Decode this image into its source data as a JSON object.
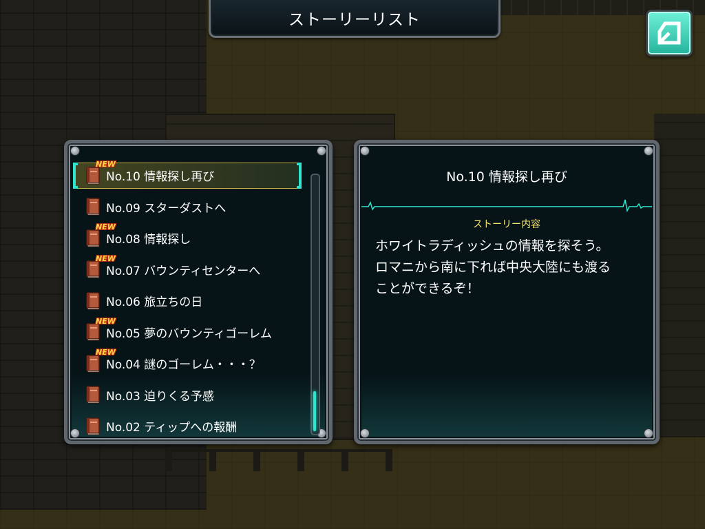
{
  "header": {
    "title": "ストーリーリスト"
  },
  "back_button": {
    "icon": "back-arrow-icon"
  },
  "story_list": {
    "selected_index": 0,
    "new_badge_label": "NEW",
    "items": [
      {
        "label": "No.10 情報探し再び",
        "is_new": true,
        "selected": true
      },
      {
        "label": "No.09 スターダストへ",
        "is_new": false,
        "selected": false
      },
      {
        "label": "No.08 情報探し",
        "is_new": true,
        "selected": false
      },
      {
        "label": "No.07 バウンティセンターへ",
        "is_new": true,
        "selected": false
      },
      {
        "label": "No.06 旅立ちの日",
        "is_new": false,
        "selected": false
      },
      {
        "label": "No.05 夢のバウンティゴーレム",
        "is_new": true,
        "selected": false
      },
      {
        "label": "No.04 謎のゴーレム・・・？",
        "is_new": true,
        "selected": false
      },
      {
        "label": "No.03 迫りくる予感",
        "is_new": false,
        "selected": false
      },
      {
        "label": "No.02 ティップへの報酬",
        "is_new": false,
        "selected": false
      }
    ]
  },
  "detail": {
    "title": "No.10 情報探し再び",
    "subheading": "ストーリー内容",
    "body_lines": [
      "ホワイトラディッシュの情報を探そう。",
      "ロマニから南に下れば中央大陸にも渡る",
      "ことができるぞ！"
    ]
  },
  "colors": {
    "accent_cyan": "#2ee6d0",
    "new_badge": "#ffd84a",
    "subheading": "#f3e06a",
    "panel_bg": "#061418"
  }
}
